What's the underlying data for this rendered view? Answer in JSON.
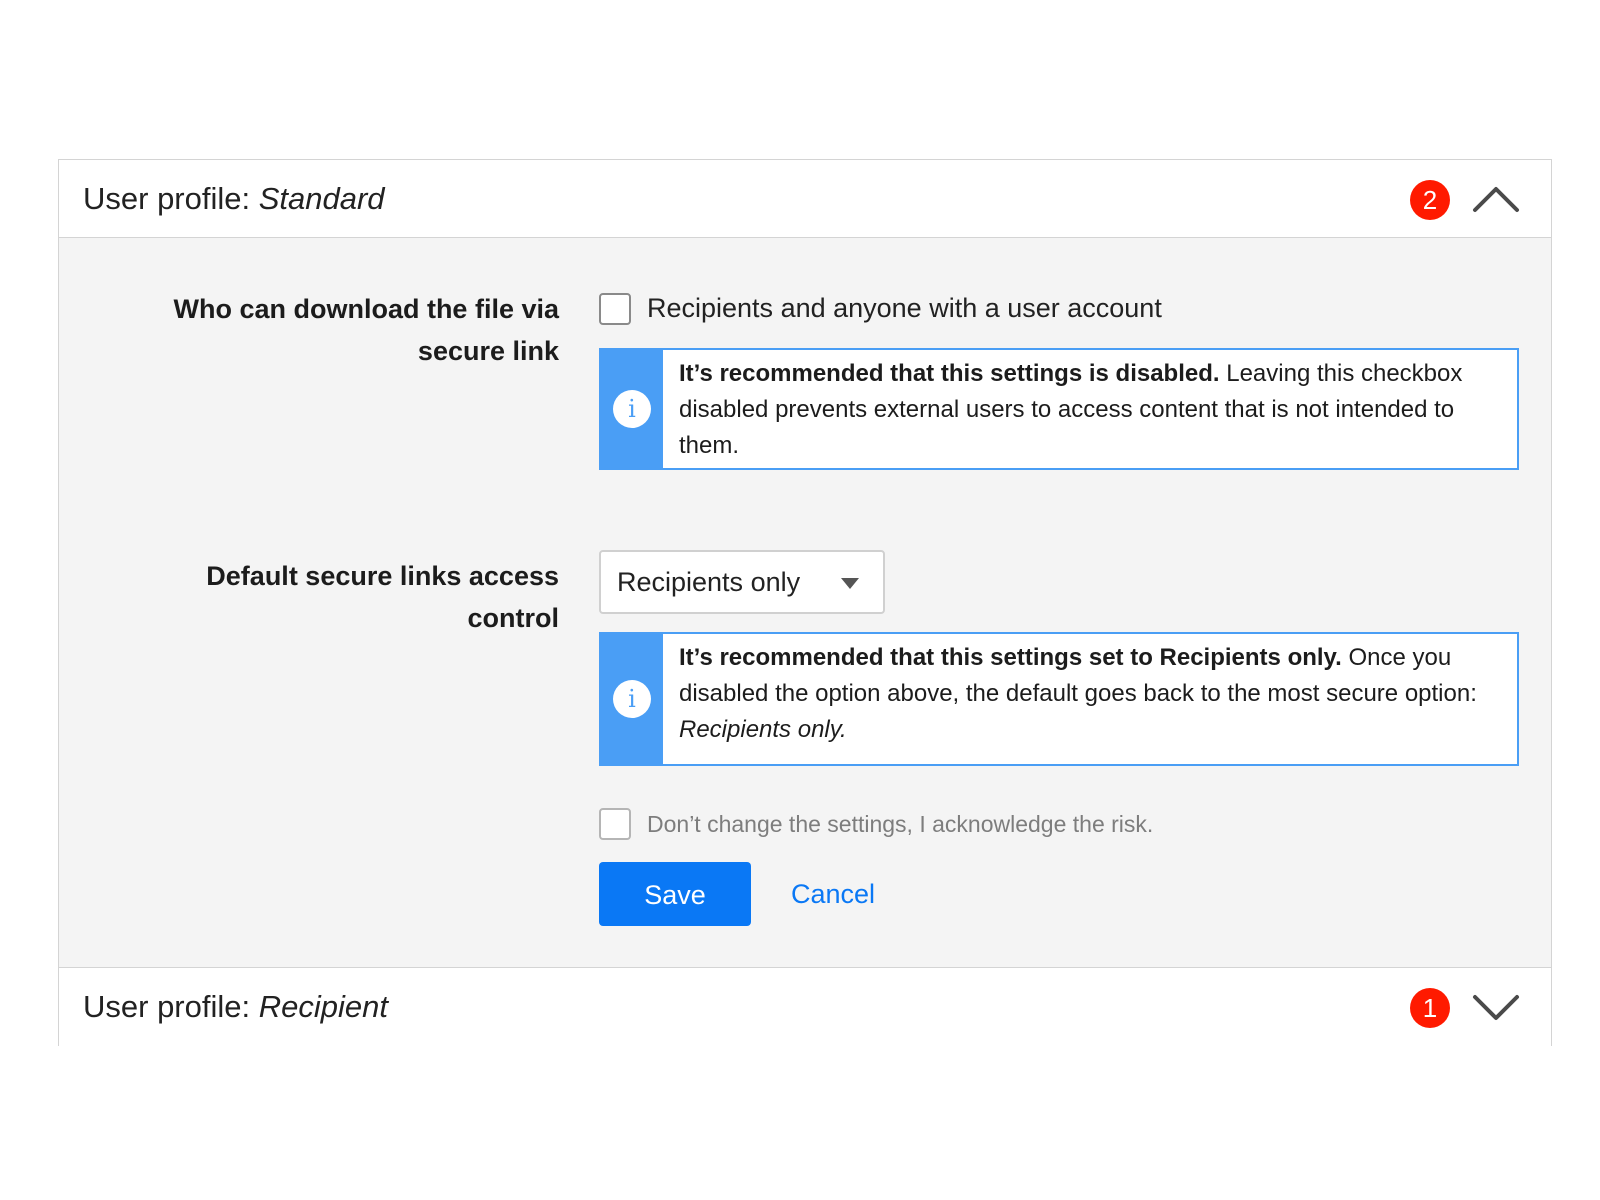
{
  "profiles": [
    {
      "title_prefix": "User profile: ",
      "title_name": "Standard",
      "badge_count": "2",
      "expanded": true,
      "chevron_icon": "chevron-up-icon"
    },
    {
      "title_prefix": "User profile: ",
      "title_name": "Recipient",
      "badge_count": "1",
      "expanded": false,
      "chevron_icon": "chevron-down-icon"
    }
  ],
  "download_setting": {
    "label_line1": "Who can download the file via",
    "label_line2": "secure link",
    "checkbox_label": "Recipients and anyone with a user account",
    "checked": false,
    "info_bold": "It’s recommended that this settings is disabled.",
    "info_text": " Leaving this checkbox disabled prevents external users to access content that is not intended to them.",
    "info_icon": "info-icon"
  },
  "access_control": {
    "label_line1": "Default secure links access",
    "label_line2": "control",
    "selected_value": "Recipients only",
    "info_bold": "It’s recommended that this settings set to Recipients only.",
    "info_text": " Once you disabled the option above, the default goes back to the most secure option: ",
    "info_italic": "Recipients only.",
    "info_icon": "info-icon"
  },
  "acknowledge": {
    "label": "Don’t change the settings, I acknowledge the risk.",
    "checked": false
  },
  "actions": {
    "save_label": "Save",
    "cancel_label": "Cancel"
  },
  "colors": {
    "badge": "#ff1a00",
    "info_accent": "#4a9ef5",
    "primary": "#0a78f5",
    "panel_bg": "#f4f4f4"
  }
}
